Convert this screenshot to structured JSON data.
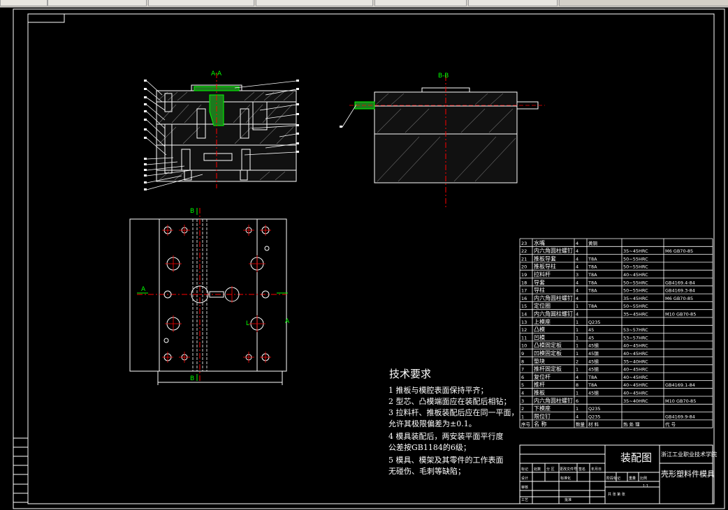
{
  "toolbar": {
    "tabs": [
      "",
      "",
      "",
      "",
      "",
      "",
      ""
    ]
  },
  "sections": {
    "aa": "A-A",
    "bb": "B-B",
    "b_top": "B",
    "b_bottom": "B",
    "a_left": "A",
    "a_right": "A",
    "l_mark": "L"
  },
  "tech": {
    "title": "技术要求",
    "items": [
      "1 推板与模腔表面保持平齐；",
      "2 型芯、凸模端面应在装配后相钻；",
      "3 拉料杆、推板装配后应在同一平面，",
      "   允许其极限偏差为±0.1。",
      "4 模具装配后，两安装平面平行度",
      "   公差按GB1184的6级；",
      "5 模具、模架及其零件的工作表面",
      "   无碰伤、毛刺等缺陷；"
    ]
  },
  "bom": {
    "rows": [
      {
        "no": "23",
        "name": "水嘴",
        "qty": "4",
        "mat": "黄铜",
        "heat": "",
        "std": ""
      },
      {
        "no": "22",
        "name": "内六角圆柱螺钉",
        "qty": "4",
        "mat": "",
        "heat": "35~45HRC",
        "std": "M6 GB70-85"
      },
      {
        "no": "21",
        "name": "推板导套",
        "qty": "4",
        "mat": "T8A",
        "heat": "50~55HRC",
        "std": ""
      },
      {
        "no": "20",
        "name": "推板导柱",
        "qty": "4",
        "mat": "T8A",
        "heat": "50~55HRC",
        "std": ""
      },
      {
        "no": "19",
        "name": "拉料杆",
        "qty": "3",
        "mat": "T8A",
        "heat": "40~45HRC",
        "std": ""
      },
      {
        "no": "18",
        "name": "导套",
        "qty": "4",
        "mat": "T8A",
        "heat": "50~55HRC",
        "std": "GB4169.4-84"
      },
      {
        "no": "17",
        "name": "导柱",
        "qty": "4",
        "mat": "T8A",
        "heat": "50~55HRC",
        "std": "GB4169.3-84"
      },
      {
        "no": "16",
        "name": "内六角圆柱螺钉",
        "qty": "4",
        "mat": "",
        "heat": "35~45HRC",
        "std": "M6 GB70-85"
      },
      {
        "no": "15",
        "name": "定位圈",
        "qty": "1",
        "mat": "T8A",
        "heat": "50~55HRC",
        "std": ""
      },
      {
        "no": "14",
        "name": "内六角圆柱螺钉",
        "qty": "4",
        "mat": "",
        "heat": "35~45HRC",
        "std": "M10 GB70-85"
      },
      {
        "no": "13",
        "name": "上模座",
        "qty": "1",
        "mat": "Q235",
        "heat": "",
        "std": ""
      },
      {
        "no": "12",
        "name": "凸模",
        "qty": "1",
        "mat": "45",
        "heat": "53~57HRC",
        "std": ""
      },
      {
        "no": "11",
        "name": "凹模",
        "qty": "1",
        "mat": "45",
        "heat": "53~57HRC",
        "std": ""
      },
      {
        "no": "10",
        "name": "凸模固定板",
        "qty": "1",
        "mat": "45钢",
        "heat": "40~45HRC",
        "std": ""
      },
      {
        "no": "9",
        "name": "凹模固定板",
        "qty": "1",
        "mat": "45钢",
        "heat": "40~45HRC",
        "std": ""
      },
      {
        "no": "8",
        "name": "垫块",
        "qty": "2",
        "mat": "45钢",
        "heat": "35~40HRC",
        "std": ""
      },
      {
        "no": "7",
        "name": "推杆固定板",
        "qty": "1",
        "mat": "45钢",
        "heat": "40~45HRC",
        "std": ""
      },
      {
        "no": "6",
        "name": "复位杆",
        "qty": "4",
        "mat": "T8A",
        "heat": "40~45HRC",
        "std": ""
      },
      {
        "no": "5",
        "name": "推杆",
        "qty": "8",
        "mat": "T8A",
        "heat": "40~45HRC",
        "std": "GB4169.1-84"
      },
      {
        "no": "4",
        "name": "推板",
        "qty": "1",
        "mat": "45钢",
        "heat": "40~45HRC",
        "std": ""
      },
      {
        "no": "3",
        "name": "内六角圆柱螺钉",
        "qty": "6",
        "mat": "",
        "heat": "35~40HRC",
        "std": "M10 GB70-85"
      },
      {
        "no": "2",
        "name": "下模座",
        "qty": "1",
        "mat": "Q235",
        "heat": "",
        "std": ""
      },
      {
        "no": "1",
        "name": "限位钉",
        "qty": "4",
        "mat": "Q235",
        "heat": "",
        "std": "GB4169.9-84"
      }
    ],
    "header": {
      "no": "序号",
      "name": "名 称",
      "qty": "数量",
      "mat": "材 料",
      "heat": "热 处 理",
      "std": "代 号"
    }
  },
  "titleblock": {
    "school": "浙江工业职业技术学院",
    "drawing": "装配图",
    "product": "壳形塑料件模具",
    "labels": [
      "标记",
      "处数",
      "分 区",
      "更改文件号",
      "签名",
      "年月日",
      "设计",
      "标准化",
      "阶段标记",
      "重量",
      "比例",
      "审核",
      "工艺",
      "批准",
      "共 张 第 张",
      "1:1"
    ]
  },
  "colors": {
    "bg": "#000000",
    "line": "#ffffff",
    "red": "#ff0000",
    "green": "#00ff00",
    "yellow": "#ffff00"
  }
}
